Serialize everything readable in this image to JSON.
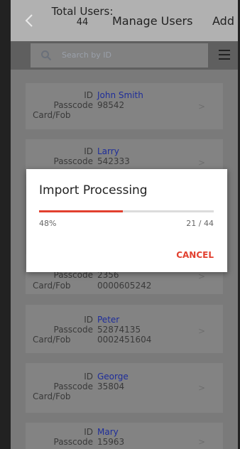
{
  "header": {
    "total_label": "Total Users:",
    "total_count": "44",
    "title": "Manage Users",
    "add_label": "Add"
  },
  "search": {
    "placeholder": "Search by ID"
  },
  "labels": {
    "id": "ID",
    "passcode": "Passcode",
    "card": "Card/Fob"
  },
  "users": [
    {
      "id": "John Smith",
      "passcode": "98542",
      "card": ""
    },
    {
      "id": "Larry",
      "passcode": "542333",
      "card": ""
    },
    {
      "id": "",
      "passcode": "2356",
      "card": "0000605242"
    },
    {
      "id": "Peter",
      "passcode": "52874135",
      "card": "0002451604"
    },
    {
      "id": "George",
      "passcode": "35804",
      "card": ""
    },
    {
      "id": "Mary",
      "passcode": "15963",
      "card": ""
    }
  ],
  "dialog": {
    "title": "Import Processing",
    "progress": 0.48,
    "percent_label": "48%",
    "count_label": "21 / 44",
    "cancel_label": "CANCEL"
  },
  "colors": {
    "accent": "#e2402f",
    "name": "#1e2d9a"
  },
  "icons": {
    "back": "chevron-left-icon",
    "search": "search-icon",
    "menu": "hamburger-menu-icon",
    "row": "chevron-right-icon"
  }
}
